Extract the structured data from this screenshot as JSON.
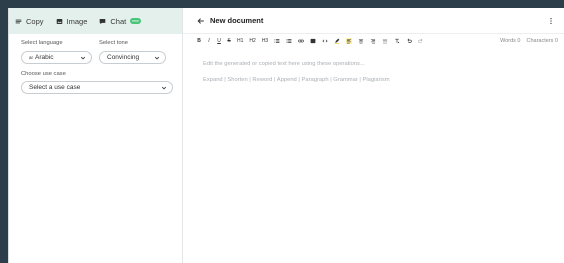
{
  "sidebar": {
    "tabs": [
      {
        "label": "Copy",
        "icon": "lines-icon"
      },
      {
        "label": "Image",
        "icon": "image-icon"
      },
      {
        "label": "Chat",
        "icon": "chat-icon",
        "badge": "new"
      }
    ],
    "language_label": "Select language",
    "tone_label": "Select tone",
    "language_prefix": "ar",
    "language_value": "Arabic",
    "tone_value": "Convincing",
    "use_case_label": "Choose use case",
    "use_case_placeholder": "Select a use case"
  },
  "editor": {
    "title": "New document",
    "toolbar_text": [
      "B",
      "I",
      "U",
      "S",
      "H1",
      "H2",
      "H3"
    ],
    "words_label": "Words 0",
    "characters_label": "Characters 0",
    "hint": "Edit the generated or copied text here using these operations...",
    "operations": "Expand | Shorten | Reword | Append | Paragraph | Grammar | Plagiarism"
  },
  "colors": {
    "accent_tab_bg": "#e3f0ec",
    "badge": "#49c47a",
    "outer_bg": "#2c3e4a"
  }
}
